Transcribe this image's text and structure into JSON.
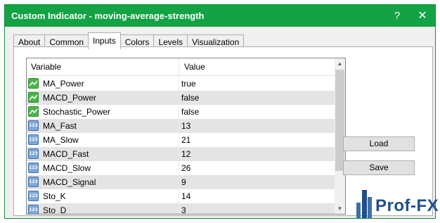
{
  "window": {
    "title": "Custom Indicator - moving-average-strength",
    "help_glyph": "?",
    "close_glyph": "✕"
  },
  "tabs": [
    {
      "label": "About",
      "active": false
    },
    {
      "label": "Common",
      "active": false
    },
    {
      "label": "Inputs",
      "active": true
    },
    {
      "label": "Colors",
      "active": false
    },
    {
      "label": "Levels",
      "active": false
    },
    {
      "label": "Visualization",
      "active": false
    }
  ],
  "table": {
    "headers": {
      "variable": "Variable",
      "value": "Value"
    },
    "rows": [
      {
        "icon": "bool",
        "variable": "MA_Power",
        "value": "true"
      },
      {
        "icon": "bool",
        "variable": "MACD_Power",
        "value": "false"
      },
      {
        "icon": "bool",
        "variable": "Stochastic_Power",
        "value": "false"
      },
      {
        "icon": "num",
        "variable": "MA_Fast",
        "value": "13"
      },
      {
        "icon": "num",
        "variable": "MA_Slow",
        "value": "21"
      },
      {
        "icon": "num",
        "variable": "MACD_Fast",
        "value": "12"
      },
      {
        "icon": "num",
        "variable": "MACD_Slow",
        "value": "26"
      },
      {
        "icon": "num",
        "variable": "MACD_Signal",
        "value": "9"
      },
      {
        "icon": "num",
        "variable": "Sto_K",
        "value": "14"
      },
      {
        "icon": "num",
        "variable": "Sto_D",
        "value": "3"
      }
    ],
    "num_icon_text": "123"
  },
  "buttons": {
    "load": "Load",
    "save": "Save"
  },
  "watermark": {
    "text": "Prof-FX"
  },
  "colors": {
    "titlebar": "#13a244",
    "logo": "#1f4f8c"
  }
}
